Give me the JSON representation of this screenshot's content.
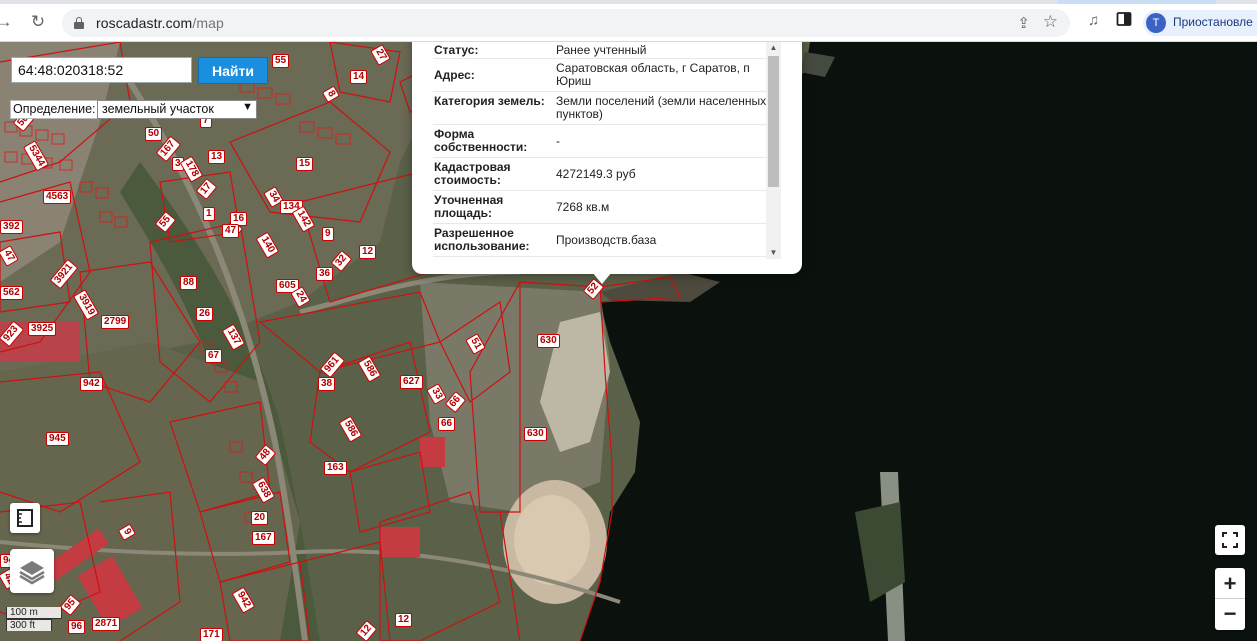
{
  "browser": {
    "url_host": "roscadastr.com",
    "url_path": "/map",
    "profile_initial": "T",
    "profile_label": "Приостановле"
  },
  "search": {
    "value": "64:48:020318:52",
    "button_label": "Найти"
  },
  "definition": {
    "label": "Определение:",
    "selected": "земельный участок"
  },
  "popup": {
    "rows": [
      {
        "key": "Статус:",
        "value": "Ранее учтенный"
      },
      {
        "key": "Адрес:",
        "value": "Саратовская область, г Саратов, п Юриш"
      },
      {
        "key": "Категория земель:",
        "value": "Земли поселений (земли населенных пунктов)"
      },
      {
        "key": "Форма собственности:",
        "value": "-"
      },
      {
        "key": "Кадастровая стоимость:",
        "value": "4272149.3 руб"
      },
      {
        "key": "Уточненная площадь:",
        "value": "7268 кв.м"
      },
      {
        "key": "Разрешенное использование:",
        "value": "Производств.база"
      }
    ]
  },
  "scale": {
    "metric": "100 m",
    "imperial": "300 ft"
  },
  "zoom": {
    "in": "+",
    "out": "−"
  },
  "parcel_labels": [
    "55",
    "27",
    "50",
    "14",
    "8",
    "7",
    "50",
    "167",
    "3",
    "13",
    "178",
    "15",
    "17",
    "34",
    "134",
    "1",
    "142",
    "5",
    "16",
    "140",
    "9",
    "12",
    "32",
    "36",
    "605",
    "24",
    "47",
    "55",
    "5344",
    "4563",
    "392",
    "47",
    "3921",
    "562",
    "3919",
    "3925",
    "2799",
    "923",
    "88",
    "26",
    "137",
    "67",
    "961",
    "586",
    "38",
    "627",
    "33",
    "66",
    "66",
    "51",
    "630",
    "630",
    "52",
    "942",
    "945",
    "586",
    "163",
    "48",
    "638",
    "20",
    "167",
    "9",
    "95",
    "2871",
    "942",
    "96",
    "12",
    "12",
    "171",
    "942",
    "42"
  ]
}
